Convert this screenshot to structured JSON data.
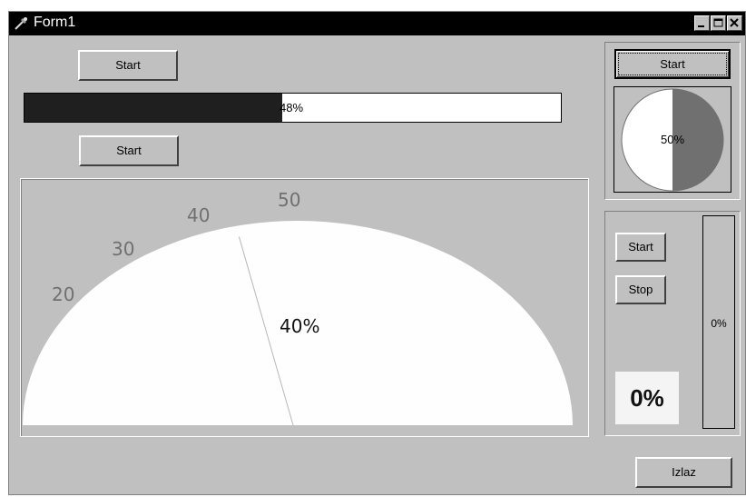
{
  "window": {
    "title": "Form1"
  },
  "buttons": {
    "start_top": "Start",
    "start_second": "Start",
    "start_pie": "Start",
    "start_right": "Start",
    "stop_right": "Stop",
    "izlaz": "Izlaz"
  },
  "progress_bar": {
    "value": 0.48,
    "label": "48%"
  },
  "gauge": {
    "value": 0.4,
    "label": "40%",
    "ticks": [
      "20",
      "30",
      "40",
      "50"
    ]
  },
  "pie_progress": {
    "value": 0.5,
    "label": "50%"
  },
  "vertical_bar": {
    "value": 0.0,
    "label": "0%"
  },
  "big_percent": {
    "label": "0%"
  }
}
